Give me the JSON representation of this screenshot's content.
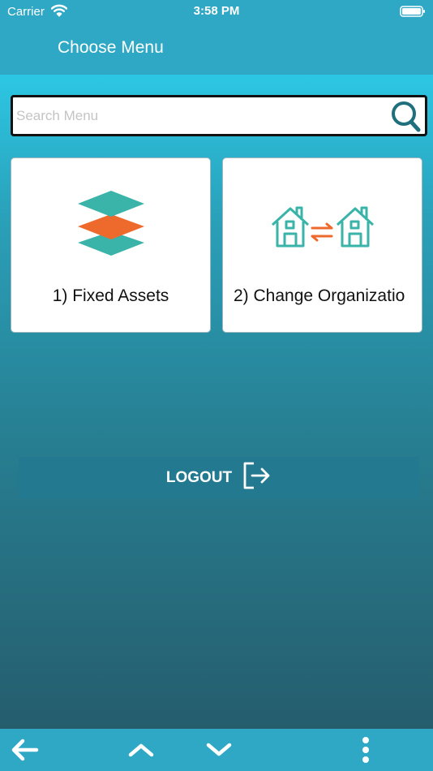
{
  "status_bar": {
    "carrier": "Carrier",
    "time": "3:58 PM"
  },
  "header": {
    "title": "Choose Menu"
  },
  "search": {
    "placeholder": "Search Menu",
    "value": ""
  },
  "menu": {
    "items": [
      {
        "label": "1) Fixed Assets",
        "icon": "layers-icon"
      },
      {
        "label": "2) Change Organizatio",
        "icon": "house-transfer-icon"
      }
    ]
  },
  "logout": {
    "label": "LOGOUT",
    "icon": "logout-icon"
  },
  "toolbar": {
    "icons": [
      "back-arrow-icon",
      "chevron-up-icon",
      "chevron-down-icon",
      "more-vertical-icon"
    ]
  },
  "colors": {
    "header": "#2fa8c6",
    "accent_teal": "#3ab3a8",
    "accent_orange": "#ee6a2c",
    "logout_button": "#23798f"
  }
}
